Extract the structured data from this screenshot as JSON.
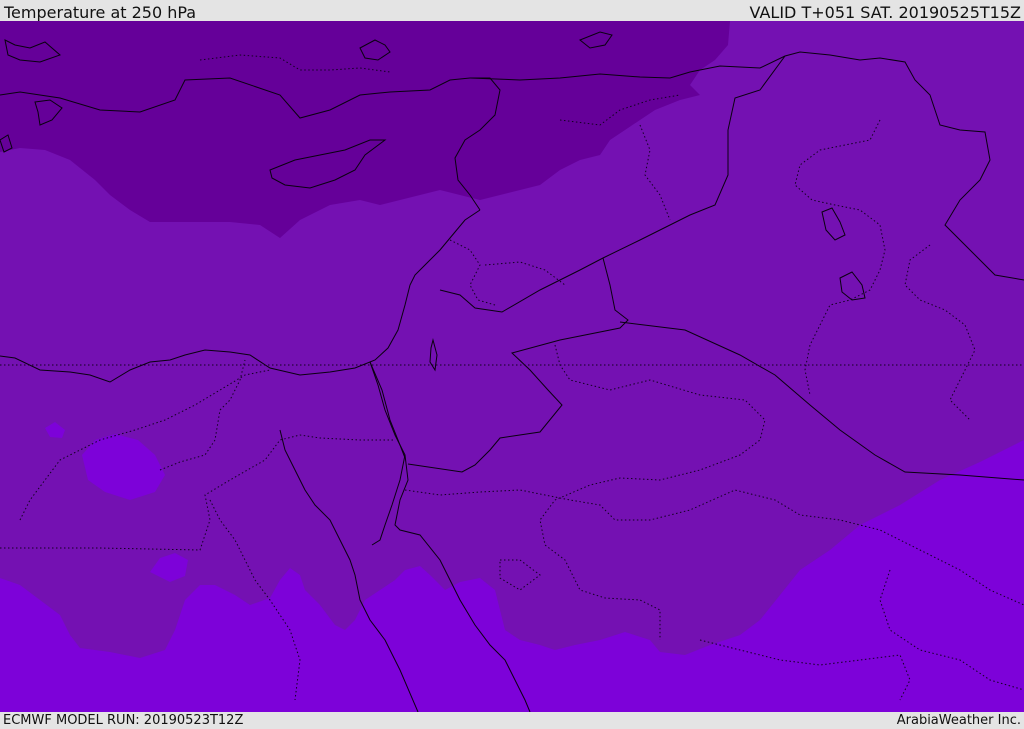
{
  "header": {
    "title": "Temperature at 250 hPa",
    "valid": "VALID T+051 SAT. 20190525T15Z"
  },
  "footer": {
    "model_run": "ECMWF MODEL RUN: 20190523T12Z",
    "credit": "ArabiaWeather Inc."
  },
  "map": {
    "colors": {
      "cold_band": "#650099",
      "mid_band": "#7411b2",
      "warm_band": "#7d02d9",
      "coastline": "#0a0010",
      "border": "#120020"
    }
  }
}
